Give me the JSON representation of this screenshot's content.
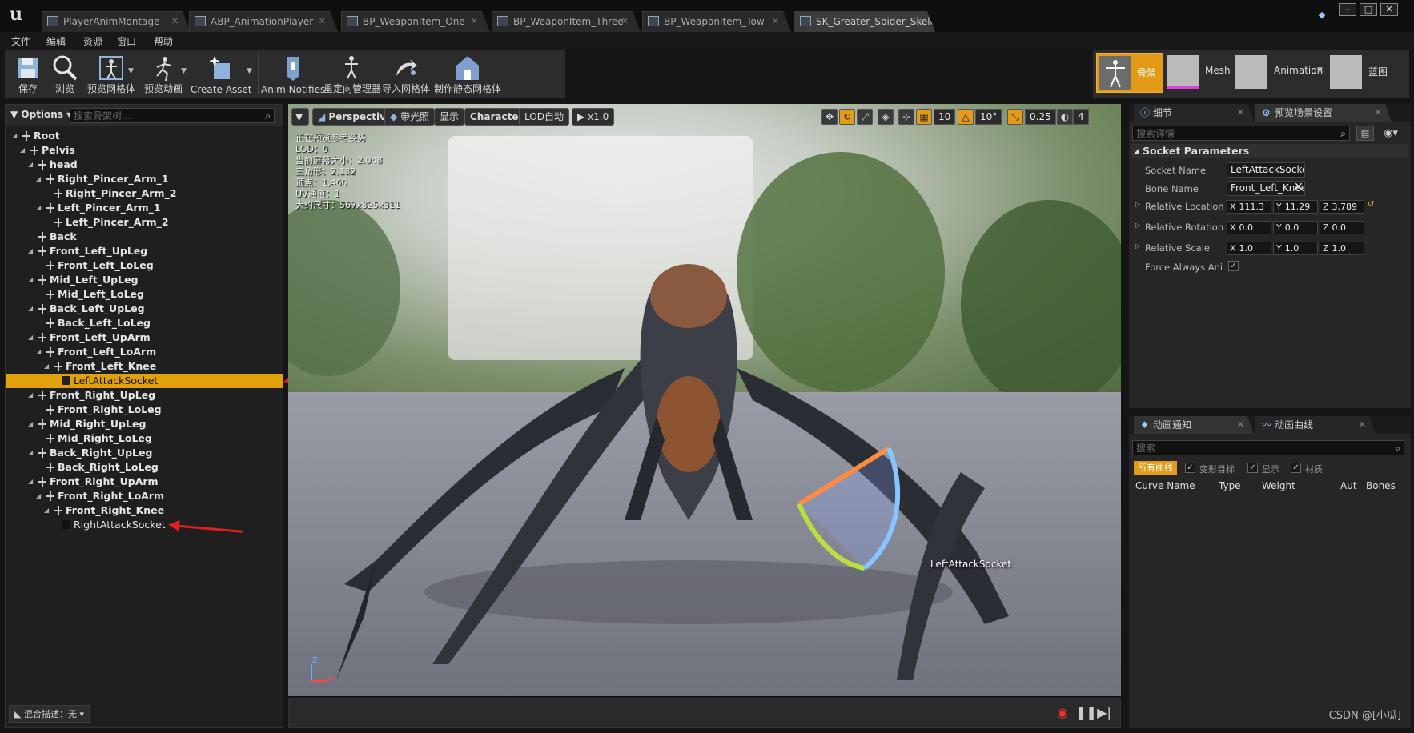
{
  "tabs": [
    {
      "label": "PlayerAnimMontage"
    },
    {
      "label": "ABP_AnimationPlayer"
    },
    {
      "label": "BP_WeaponItem_One"
    },
    {
      "label": "BP_WeaponItem_Three"
    },
    {
      "label": "BP_WeaponItem_Tow"
    },
    {
      "label": "SK_Greater_Spider_Skelet"
    }
  ],
  "menu": [
    "文件",
    "编辑",
    "资源",
    "窗口",
    "帮助"
  ],
  "toolbar": [
    {
      "label": "保存",
      "icon": "save-icon"
    },
    {
      "label": "浏览",
      "icon": "browse-icon"
    },
    {
      "label": "预览网格体",
      "icon": "preview-mesh-icon"
    },
    {
      "label": "预览动画",
      "icon": "preview-animation-icon"
    },
    {
      "label": "Create Asset",
      "icon": "create-asset-icon"
    },
    {
      "label": "Anim Notifies",
      "icon": "anim-notifies-icon"
    },
    {
      "label": "重定向管理器",
      "icon": "retarget-manager-icon"
    },
    {
      "label": "导入网格体",
      "icon": "import-mesh-icon"
    },
    {
      "label": "制作静态网格体",
      "icon": "make-static-mesh-icon"
    }
  ],
  "modes": [
    {
      "label": "骨架",
      "active": true
    },
    {
      "label": "Mesh"
    },
    {
      "label": "Animation"
    },
    {
      "label": "蓝图"
    }
  ],
  "skeleton_tree": {
    "options_label": "Options",
    "search_placeholder": "搜索骨架树...",
    "blend_label": "混合描述：无",
    "rows": [
      {
        "label": "Root",
        "depth": 0,
        "type": "bone",
        "expanded": true
      },
      {
        "label": "Pelvis",
        "depth": 1,
        "type": "bone",
        "expanded": true
      },
      {
        "label": "head",
        "depth": 2,
        "type": "bone",
        "expanded": true
      },
      {
        "label": "Right_Pincer_Arm_1",
        "depth": 3,
        "type": "bone",
        "expanded": true
      },
      {
        "label": "Right_Pincer_Arm_2",
        "depth": 4,
        "type": "bone"
      },
      {
        "label": "Left_Pincer_Arm_1",
        "depth": 3,
        "type": "bone",
        "expanded": true
      },
      {
        "label": "Left_Pincer_Arm_2",
        "depth": 4,
        "type": "bone"
      },
      {
        "label": "Back",
        "depth": 2,
        "type": "bone"
      },
      {
        "label": "Front_Left_UpLeg",
        "depth": 2,
        "type": "bone",
        "expanded": true
      },
      {
        "label": "Front_Left_LoLeg",
        "depth": 3,
        "type": "bone"
      },
      {
        "label": "Mid_Left_UpLeg",
        "depth": 2,
        "type": "bone",
        "expanded": true
      },
      {
        "label": "Mid_Left_LoLeg",
        "depth": 3,
        "type": "bone"
      },
      {
        "label": "Back_Left_UpLeg",
        "depth": 2,
        "type": "bone",
        "expanded": true
      },
      {
        "label": "Back_Left_LoLeg",
        "depth": 3,
        "type": "bone"
      },
      {
        "label": "Front_Left_UpArm",
        "depth": 2,
        "type": "bone",
        "expanded": true
      },
      {
        "label": "Front_Left_LoArm",
        "depth": 3,
        "type": "bone",
        "expanded": true
      },
      {
        "label": "Front_Left_Knee",
        "depth": 4,
        "type": "bone",
        "expanded": true
      },
      {
        "label": "LeftAttackSocket",
        "depth": 5,
        "type": "socket",
        "selected": true
      },
      {
        "label": "Front_Right_UpLeg",
        "depth": 2,
        "type": "bone",
        "expanded": true
      },
      {
        "label": "Front_Right_LoLeg",
        "depth": 3,
        "type": "bone"
      },
      {
        "label": "Mid_Right_UpLeg",
        "depth": 2,
        "type": "bone",
        "expanded": true
      },
      {
        "label": "Mid_Right_LoLeg",
        "depth": 3,
        "type": "bone"
      },
      {
        "label": "Back_Right_UpLeg",
        "depth": 2,
        "type": "bone",
        "expanded": true
      },
      {
        "label": "Back_Right_LoLeg",
        "depth": 3,
        "type": "bone"
      },
      {
        "label": "Front_Right_UpArm",
        "depth": 2,
        "type": "bone",
        "expanded": true
      },
      {
        "label": "Front_Right_LoArm",
        "depth": 3,
        "type": "bone",
        "expanded": true
      },
      {
        "label": "Front_Right_Knee",
        "depth": 4,
        "type": "bone",
        "expanded": true
      },
      {
        "label": "RightAttackSocket",
        "depth": 5,
        "type": "socket"
      }
    ]
  },
  "viewport": {
    "buttons": [
      "Perspective",
      "带光照",
      "显示",
      "Character",
      "LOD自动",
      "x1.0"
    ],
    "grid_snap": "10",
    "rot_snap": "10°",
    "scale_snap": "0.25",
    "camera_speed": "4",
    "stats": [
      "正在预览参考姿势",
      "LOD：0",
      "当前屏幕大小：2.048",
      "三角形：2,132",
      "顶点：1,460",
      "UV通道：1",
      "大约尺寸：567x825x311"
    ],
    "socket_label": "LeftAttackSocket",
    "axis_z": "Z",
    "axis_x": "X"
  },
  "details": {
    "tab_details": "细节",
    "tab_preview": "预览场景设置",
    "search_placeholder": "搜索详情",
    "section": "Socket Parameters",
    "socket_name_label": "Socket Name",
    "socket_name": "LeftAttackSocket",
    "bone_name_label": "Bone Name",
    "bone_name": "Front_Left_Knee",
    "rel_loc_label": "Relative Location",
    "rel_loc": {
      "x": "111.3",
      "y": "11.29",
      "z": "3.789"
    },
    "rel_rot_label": "Relative Rotation",
    "rel_rot": {
      "x": "0.0",
      "y": "0.0",
      "z": "0.0"
    },
    "rel_scale_label": "Relative Scale",
    "rel_scale": {
      "x": "1.0",
      "y": "1.0",
      "z": "1.0"
    },
    "force_anim_label": "Force Always Anima"
  },
  "curves": {
    "tab_notifies": "动画通知",
    "tab_curves": "动画曲线",
    "search_placeholder": "搜索",
    "filter_all": "所有曲线",
    "filter_morph": "变形目标",
    "filter_show": "显示",
    "filter_material": "材质",
    "col_name": "Curve Name",
    "col_type": "Type",
    "col_weight": "Weight",
    "col_aut": "Aut",
    "col_bones": "Bones"
  },
  "watermark": "CSDN @[小瓜]"
}
